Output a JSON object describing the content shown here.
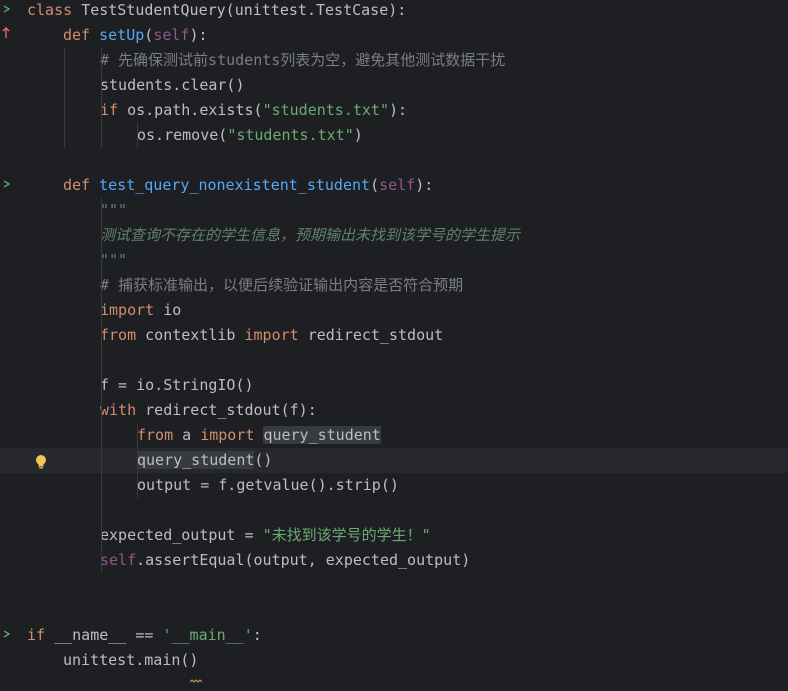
{
  "editor": {
    "lines": [
      {
        "tokens": [
          {
            "t": "kw",
            "v": "class "
          },
          {
            "t": "txt",
            "v": "TestStudentQuery(unittest.TestCase):"
          }
        ]
      },
      {
        "tokens": [
          {
            "t": "kw",
            "v": "def "
          },
          {
            "t": "fn",
            "v": "setUp"
          },
          {
            "t": "txt",
            "v": "("
          },
          {
            "t": "self",
            "v": "self"
          },
          {
            "t": "txt",
            "v": "):"
          }
        ]
      },
      {
        "tokens": [
          {
            "t": "cmt",
            "v": "# 先确保测试前students列表为空，避免其他测试数据干扰"
          }
        ]
      },
      {
        "tokens": [
          {
            "t": "txt",
            "v": "students.clear()"
          }
        ]
      },
      {
        "tokens": [
          {
            "t": "kw",
            "v": "if "
          },
          {
            "t": "txt",
            "v": "os.path.exists("
          },
          {
            "t": "str",
            "v": "\"students.txt\""
          },
          {
            "t": "txt",
            "v": "):"
          }
        ]
      },
      {
        "tokens": [
          {
            "t": "txt",
            "v": "os.remove("
          },
          {
            "t": "str",
            "v": "\"students.txt\""
          },
          {
            "t": "txt",
            "v": ")"
          }
        ]
      },
      {
        "tokens": []
      },
      {
        "tokens": [
          {
            "t": "kw",
            "v": "def "
          },
          {
            "t": "fn",
            "v": "test_query_nonexistent_student"
          },
          {
            "t": "txt",
            "v": "("
          },
          {
            "t": "self",
            "v": "self"
          },
          {
            "t": "txt",
            "v": "):"
          }
        ]
      },
      {
        "tokens": [
          {
            "t": "doc",
            "v": "\"\"\""
          }
        ]
      },
      {
        "tokens": [
          {
            "t": "doc",
            "v": "测试查询不存在的学生信息，预期输出未找到该学号的学生提示"
          }
        ]
      },
      {
        "tokens": [
          {
            "t": "doc",
            "v": "\"\"\""
          }
        ]
      },
      {
        "tokens": [
          {
            "t": "cmt",
            "v": "# 捕获标准输出，以便后续验证输出内容是否符合预期"
          }
        ]
      },
      {
        "tokens": [
          {
            "t": "kw",
            "v": "import "
          },
          {
            "t": "txt",
            "v": "io"
          }
        ]
      },
      {
        "tokens": [
          {
            "t": "kw",
            "v": "from "
          },
          {
            "t": "txt",
            "v": "contextlib "
          },
          {
            "t": "kw",
            "v": "import "
          },
          {
            "t": "txt",
            "v": "redirect_stdout"
          }
        ]
      },
      {
        "tokens": []
      },
      {
        "tokens": [
          {
            "t": "txt",
            "v": "f = io.StringIO()"
          }
        ]
      },
      {
        "tokens": [
          {
            "t": "kw",
            "v": "with "
          },
          {
            "t": "txt",
            "v": "redirect_stdout(f):"
          }
        ]
      },
      {
        "tokens": [
          {
            "t": "kw",
            "v": "from "
          },
          {
            "t": "txt",
            "v": "a "
          },
          {
            "t": "kw",
            "v": "import "
          },
          {
            "t": "txt hl",
            "v": "query_student"
          }
        ]
      },
      {
        "tokens": [
          {
            "t": "txt hl",
            "v": "query_student"
          },
          {
            "t": "txt",
            "v": "()"
          }
        ]
      },
      {
        "tokens": [
          {
            "t": "txt",
            "v": "output = f.getvalue().strip()"
          }
        ]
      },
      {
        "tokens": []
      },
      {
        "tokens": [
          {
            "t": "txt",
            "v": "expected_output = "
          },
          {
            "t": "str",
            "v": "\"未找到该学号的学生！\""
          }
        ]
      },
      {
        "tokens": [
          {
            "t": "self",
            "v": "self"
          },
          {
            "t": "txt",
            "v": ".assertEqual(output, expected_output)"
          }
        ]
      },
      {
        "tokens": []
      },
      {
        "tokens": []
      },
      {
        "tokens": [
          {
            "t": "kw",
            "v": "if "
          },
          {
            "t": "txt",
            "v": "__name__ == "
          },
          {
            "t": "str",
            "v": "'__main__'"
          },
          {
            "t": "txt",
            "v": ":"
          }
        ]
      },
      {
        "tokens": [
          {
            "t": "txt",
            "v": "unittest.main()"
          }
        ]
      }
    ]
  },
  "gutter": {
    "run_marker_icon": "run-arrow-icon",
    "override_marker_icon": "override-up-arrow-icon",
    "intention_icon": "lightbulb-icon"
  },
  "theme": {
    "background": "#1e1f22",
    "keyword": "#cf8e6d",
    "function": "#56a8f5",
    "string": "#6aab73",
    "comment": "#7a7e85",
    "self": "#94558d"
  }
}
